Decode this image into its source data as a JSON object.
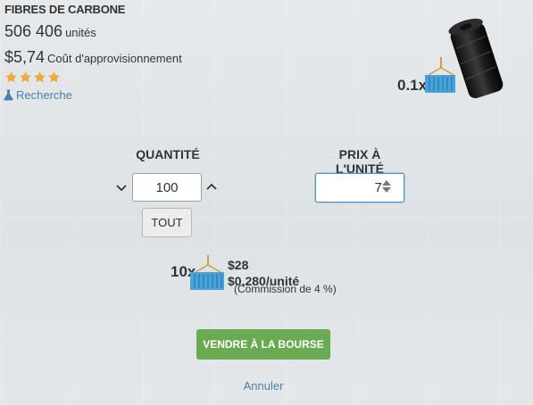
{
  "product": {
    "name": "FIBRES DE CARBONE",
    "units_value": "506 406",
    "units_label": "unités",
    "cost_value": "$5,74",
    "cost_label": "Coût d'approvisionnement",
    "rating": 4,
    "research_link": "Recherche"
  },
  "shipping_small": {
    "multiplier": "0.1x",
    "icon": "shipping-container-icon"
  },
  "form": {
    "quantity_label": "QUANTITÉ",
    "quantity_value": "100",
    "all_button": "TOUT",
    "price_label": "PRIX À L'UNITÉ",
    "price_value": "7"
  },
  "summary": {
    "multiplier": "10x",
    "total": "$28",
    "per_unit": "$0.280/unité",
    "commission": "(Commission de 4 %)"
  },
  "actions": {
    "sell_button": "VENDRE À LA BOURSE",
    "cancel_link": "Annuler"
  },
  "colors": {
    "accent_blue": "#4a7fa8",
    "sell_green": "#6aaa52",
    "star_gold": "#f2a83a"
  }
}
